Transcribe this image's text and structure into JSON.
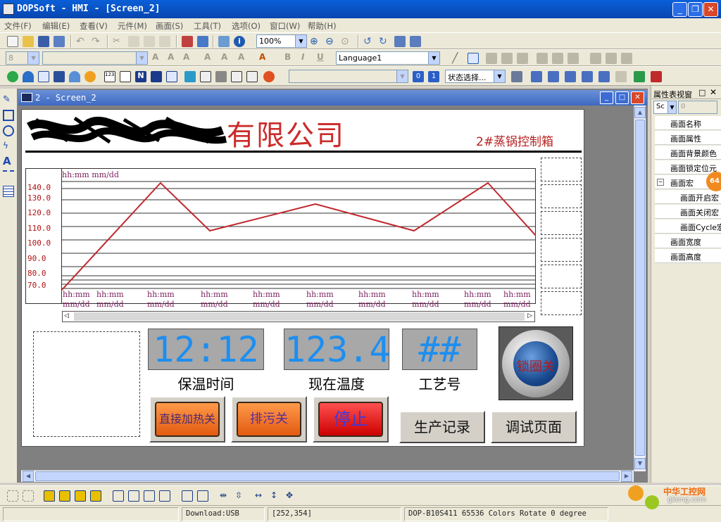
{
  "window": {
    "title": "DOPSoft - HMI - [Screen_2]"
  },
  "menu": [
    "文件(F)",
    "编辑(E)",
    "查看(V)",
    "元件(M)",
    "画面(S)",
    "工具(T)",
    "选项(O)",
    "窗口(W)",
    "帮助(H)"
  ],
  "toolbar": {
    "zoom": "100%",
    "font_size": "8",
    "language": "Language1",
    "state_select": "状态选择...",
    "state0": "0",
    "state1": "1"
  },
  "child_window": {
    "title": "2 - Screen_2"
  },
  "screen": {
    "company_name": "有限公司",
    "subtitle": "2#蒸锅控制箱",
    "trend": {
      "time_format": "hh:mm  mm/dd",
      "y_ticks": [
        "140.0",
        "130.0",
        "120.0",
        "110.0",
        "100.0",
        "90.0",
        "80.0",
        "70.0"
      ],
      "x_labels": [
        {
          "t": "hh:mm",
          "d": "mm/dd"
        },
        {
          "t": "hh:mm",
          "d": "mm/dd"
        },
        {
          "t": "hh:mm",
          "d": "mm/dd"
        },
        {
          "t": "hh:mm",
          "d": "mm/dd"
        },
        {
          "t": "hh:mm",
          "d": "mm/dd"
        },
        {
          "t": "hh:mm",
          "d": "mm/dd"
        },
        {
          "t": "hh:mm",
          "d": "mm/dd"
        },
        {
          "t": "hh:mm",
          "d": "mm/dd"
        },
        {
          "t": "hh:mm",
          "d": "mm/dd"
        },
        {
          "t": "hh:mm",
          "d": "mm/dd"
        }
      ],
      "line_color": "#c0282e"
    },
    "hold_time": {
      "value": "12:12",
      "label": "保温时间"
    },
    "current_temp": {
      "value": "123.4",
      "label": "现在温度"
    },
    "process_no": {
      "value": "##",
      "label": "工艺号"
    },
    "lock_button": {
      "label": "锁圈关"
    },
    "buttons": {
      "direct_heat": "直接加热关",
      "drain": "排污关",
      "stop": "停止",
      "production_log": "生产记录",
      "debug_page": "调试页面"
    }
  },
  "properties": {
    "title": "属性表视窗",
    "combo": "Sc",
    "combo_value": "0",
    "items": [
      "画面名称",
      "画面属性",
      "画面背景颜色",
      "画面锁定位元",
      "画面宏",
      "画面开启宏",
      "画面关闭宏",
      "画面Cycle宏",
      "画面宽度",
      "画面高度"
    ],
    "badge": "64"
  },
  "status": {
    "download": "Download:USB",
    "coords": "[252,354]",
    "device": "DOP-B10S411 65536 Colors Rotate 0 degree"
  },
  "watermark": {
    "line1": "中华工控网",
    "line2": "gkong.com"
  }
}
